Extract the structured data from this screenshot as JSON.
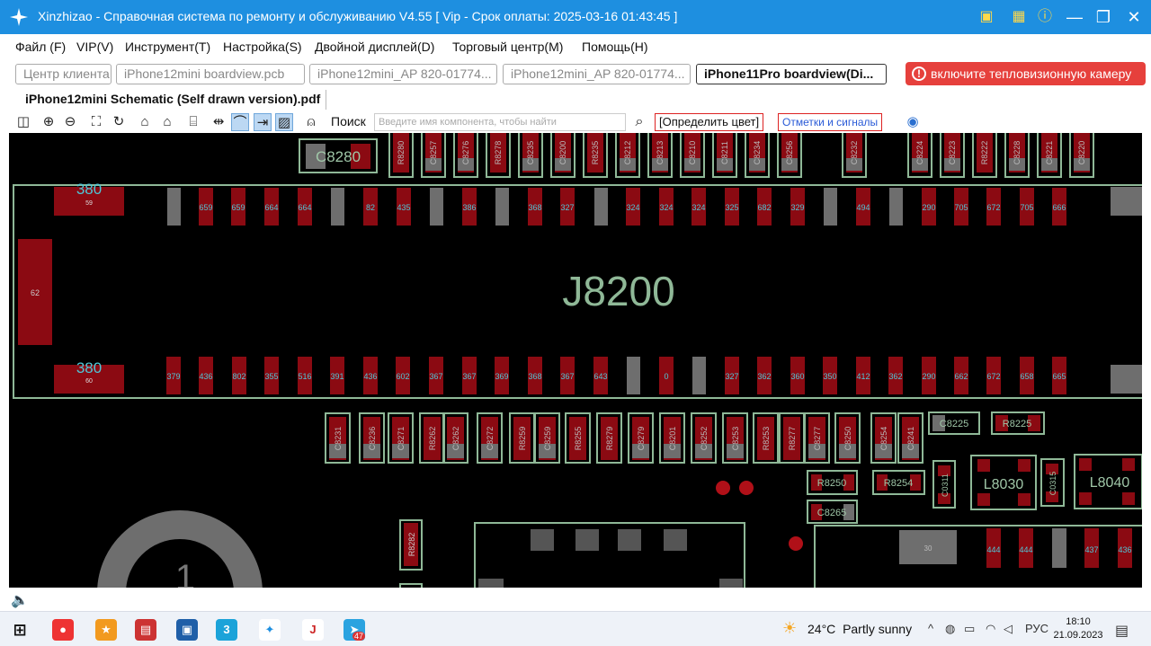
{
  "window": {
    "title": "Xinzhizao - Справочная система по ремонту и обслуживанию V4.55 [ Vip - Срок оплаты: 2025-03-16 01:43:45 ]"
  },
  "menu": [
    "Файл (F)",
    "VIP(V)",
    "Инструмент(T)",
    "Настройка(S)",
    "Двойной дисплей(D)",
    "Торговый центр(M)",
    "Помощь(H)"
  ],
  "tabs": [
    "Центр клиента",
    "iPhone12mini boardview.pcb",
    "iPhone12mini_AP 820-01774...",
    "iPhone12mini_AP 820-01774...",
    "iPhone11Pro boardview(Di..."
  ],
  "thermal_button": "включите тепловизионную камеру",
  "doc_tab": "iPhone12mini Schematic (Self drawn version).pdf",
  "toolbar": {
    "search_label": "Поиск",
    "search_placeholder": "Введите имя компонента, чтобы найти",
    "color_button": "[Определить цвет]",
    "signals_button": "Отметки и сигналы"
  },
  "board": {
    "connector": "J8200",
    "pad_380": "380",
    "left_pad": "62",
    "pad59": "59",
    "pad60": "60",
    "top_components": [
      "R8280",
      "C8257",
      "C8276",
      "R8278",
      "C8235",
      "C8200",
      "R8235",
      "C8212",
      "C8213",
      "C8210",
      "C8211",
      "C8234",
      "C8256",
      "C8232",
      "C8224",
      "C8223",
      "R8222",
      "C8228",
      "C8221",
      "C8220"
    ],
    "top_box": "C8280",
    "row1_labels": [
      "659",
      "659",
      "664",
      "664",
      "82",
      "435",
      "386",
      "368",
      "327",
      "324",
      "324",
      "324",
      "325",
      "682",
      "329",
      "494",
      "290",
      "705",
      "672",
      "705",
      "666"
    ],
    "row2_labels": [
      "379",
      "436",
      "802",
      "355",
      "516",
      "391",
      "436",
      "602",
      "367",
      "367",
      "369",
      "368",
      "367",
      "643",
      "0",
      "327",
      "362",
      "360",
      "350",
      "412",
      "362",
      "290",
      "662",
      "672",
      "658",
      "665"
    ],
    "bottom_components": [
      "C8231",
      "C8236",
      "C8271",
      "R8262",
      "C8262",
      "C8272",
      "R8259",
      "C8259",
      "R8255",
      "R8279",
      "C8279",
      "C8201",
      "C8252",
      "C8253",
      "R8253",
      "R8277",
      "C8277",
      "C8250",
      "C8254",
      "C8241"
    ],
    "side_components": [
      "C8225",
      "R8225",
      "R8250",
      "R8254",
      "C8265",
      "C0311",
      "L8030",
      "C0315",
      "L8040",
      "R8282"
    ],
    "misc_numbers": [
      "30",
      "444",
      "444",
      "437",
      "436"
    ],
    "big_circle_label": "1"
  },
  "taskbar": {
    "temp": "24°C",
    "weather": "Partly sunny",
    "lang": "РУС",
    "time": "18:10",
    "date": "21.09.2023",
    "badge": "47"
  },
  "colors": {
    "title_bar": "#1e8fe0",
    "pad_red": "#8b0a12",
    "pad_grey": "#6e6e6e",
    "outline": "#8fb897",
    "label": "#4fc6d6",
    "thermal": "#e6403c"
  }
}
